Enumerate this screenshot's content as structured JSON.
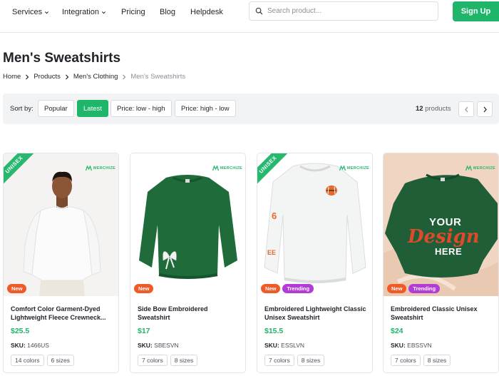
{
  "nav": {
    "services": "Services",
    "integration": "Integration",
    "pricing": "Pricing",
    "blog": "Blog",
    "helpdesk": "Helpdesk"
  },
  "search": {
    "placeholder": "Search product..."
  },
  "signup_label": "Sign Up",
  "page_title": "Men's Sweatshirts",
  "breadcrumb": {
    "home": "Home",
    "products": "Products",
    "mens_clothing": "Men's Clothing",
    "current": "Men's Sweatshirts"
  },
  "sortbar": {
    "label": "Sort by:",
    "options": [
      "Popular",
      "Latest",
      "Price: low - high",
      "Price: high - low"
    ],
    "active": "Latest",
    "count_number": "12",
    "count_label": "products"
  },
  "colors": {
    "accent": "#1fb56a",
    "new_badge": "#f05a28",
    "trending_badge": "#b43cd6"
  },
  "brand_text": "MERCHIZE",
  "products": [
    {
      "ribbon": "UNISEX",
      "badges": [
        "New"
      ],
      "name": "Comfort Color Garment-Dyed Lightweight Fleece Crewneck...",
      "price": "$25.5",
      "sku_label": "SKU:",
      "sku": "1466US",
      "colors": "14 colors",
      "sizes": "6 sizes"
    },
    {
      "ribbon": "",
      "badges": [
        "New"
      ],
      "name": "Side Bow Embroidered Sweatshirt",
      "price": "$17",
      "sku_label": "SKU:",
      "sku": "SBESVN",
      "colors": "7 colors",
      "sizes": "8 sizes"
    },
    {
      "ribbon": "UNISEX",
      "badges": [
        "New",
        "Trending"
      ],
      "name": "Embroidered Lightweight Classic Unisex Sweatshirt",
      "price": "$15.5",
      "sku_label": "SKU:",
      "sku": "ESSLVN",
      "colors": "7 colors",
      "sizes": "8 sizes"
    },
    {
      "ribbon": "",
      "badges": [
        "New",
        "Trending"
      ],
      "name": "Embroidered Classic Unisex Sweatshirt",
      "price": "$24",
      "sku_label": "SKU:",
      "sku": "EBSSVN",
      "colors": "7 colors",
      "sizes": "8 sizes",
      "image_text_1": "YOUR",
      "image_text_2": "Design",
      "image_text_3": "HERE"
    }
  ]
}
